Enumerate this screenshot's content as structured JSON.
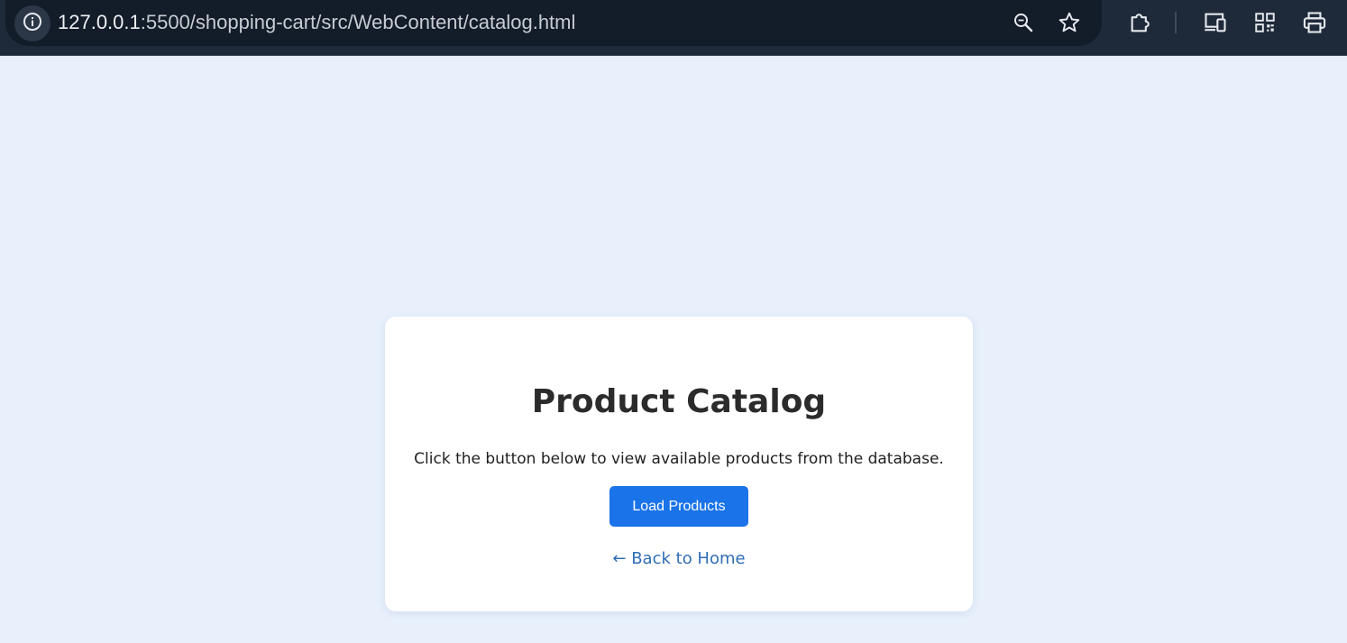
{
  "browser": {
    "url_host": "127.0.0.1",
    "url_rest": ":5500/shopping-cart/src/WebContent/catalog.html",
    "icons": [
      "info-icon",
      "zoom-icon",
      "bookmark-star-icon",
      "extensions-icon",
      "devices-icon",
      "qr-code-icon",
      "print-icon"
    ]
  },
  "page": {
    "title": "Product Catalog",
    "subtitle": "Click the button below to view available products from the database.",
    "load_button": "Load Products",
    "back_link": "← Back to Home"
  },
  "colors": {
    "page_background": "#e8f0fc",
    "browser_bar": "#1e2a3a",
    "button": "#1a73e8",
    "link": "#2f6db5"
  }
}
